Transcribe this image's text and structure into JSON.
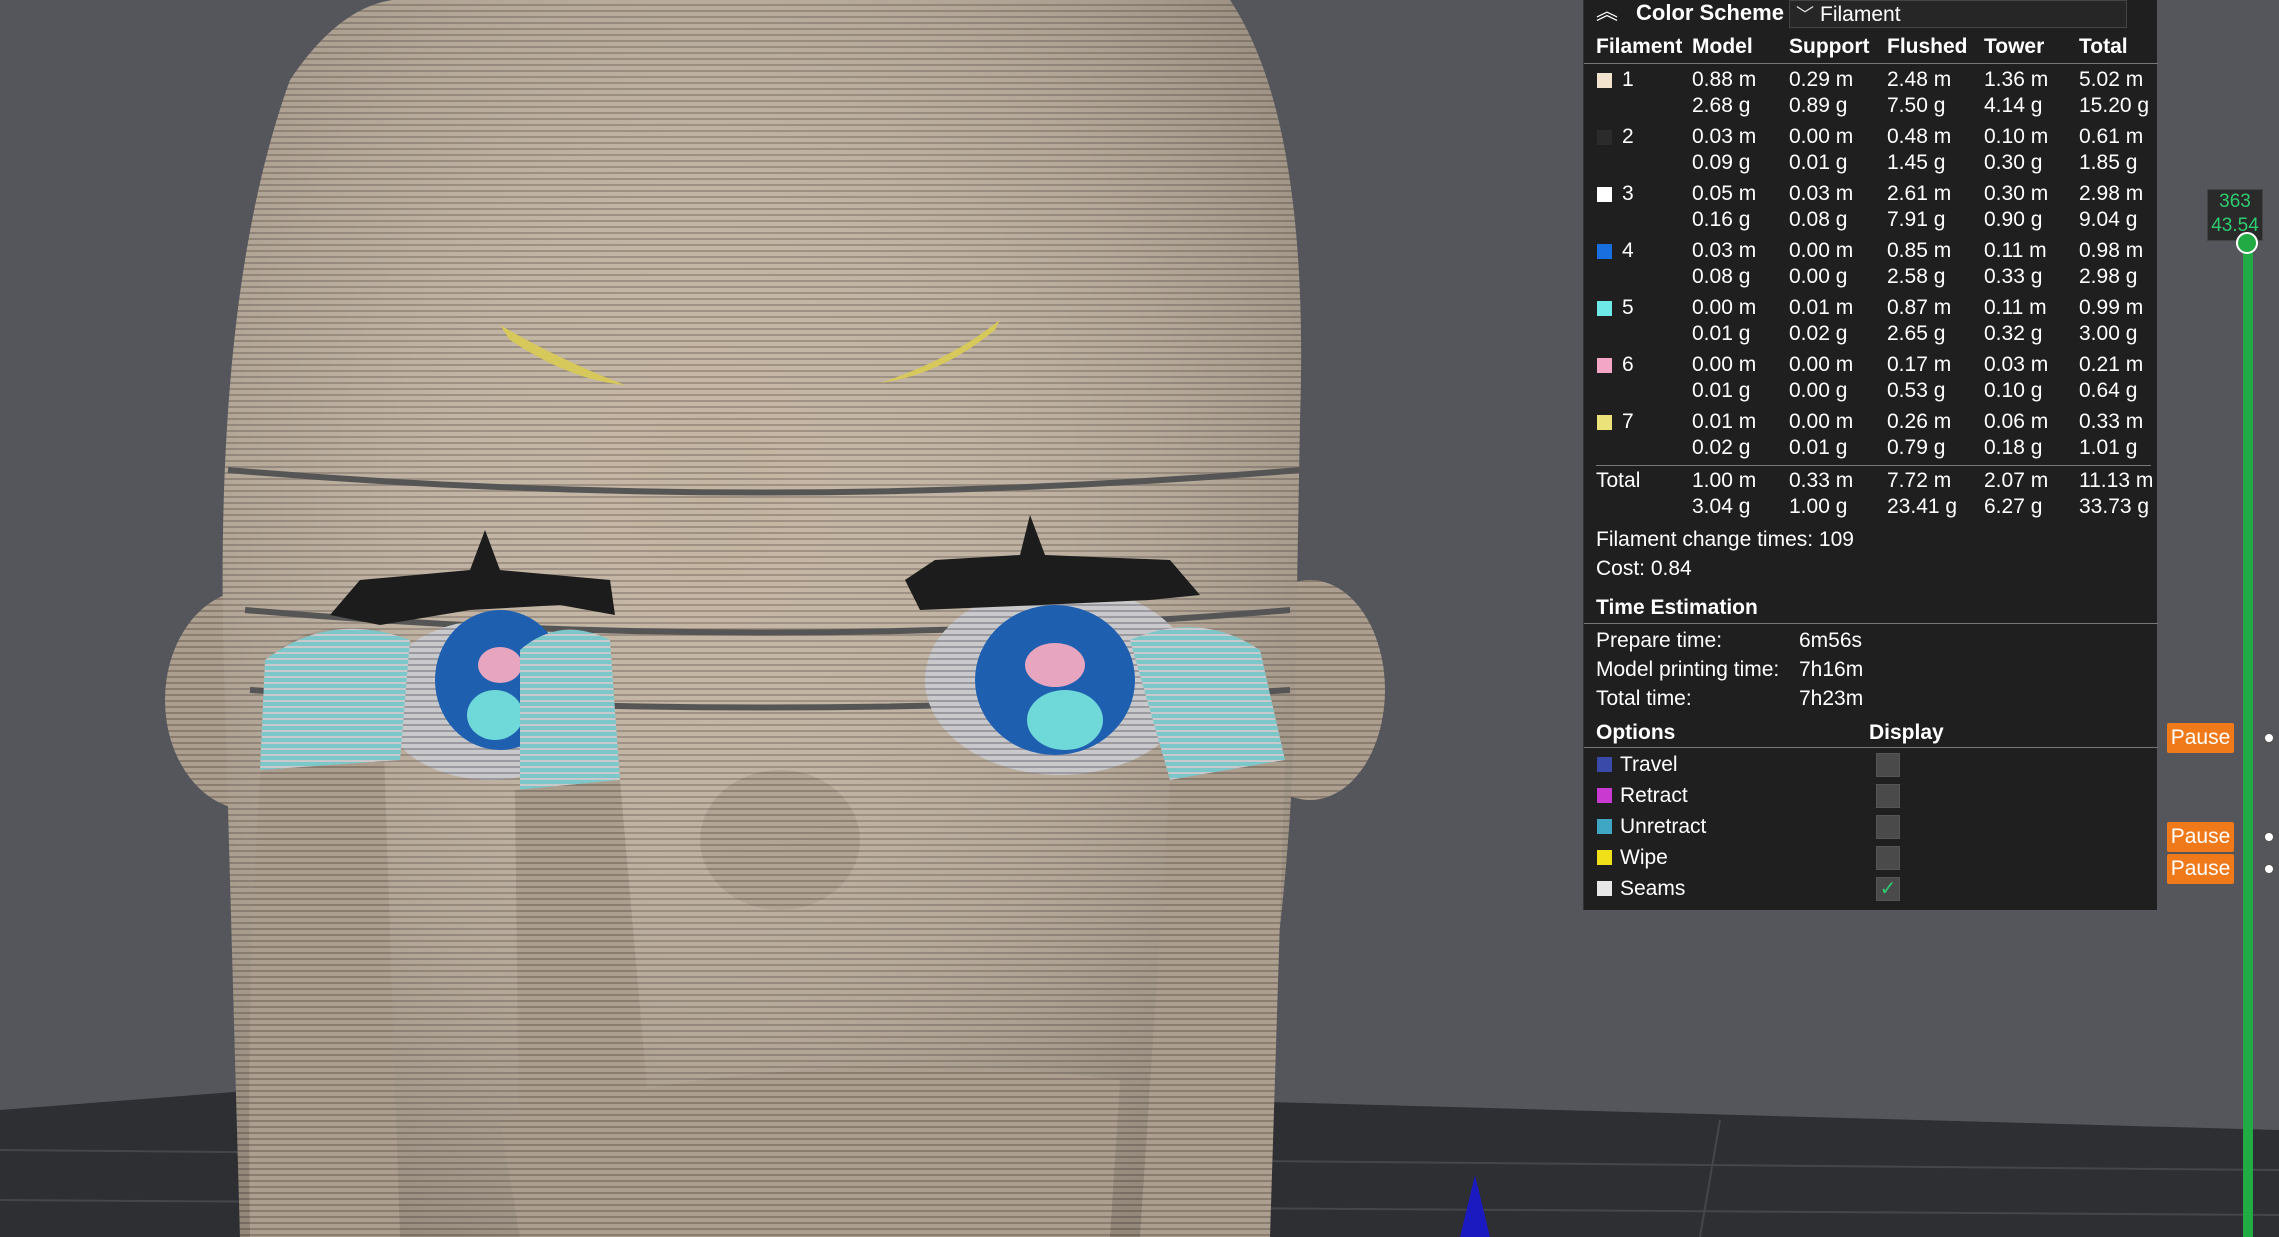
{
  "colors": {
    "background": "#55565c",
    "panel": "#1f1f1f",
    "accent_green": "#22aa44",
    "pause_orange": "#f07a1a"
  },
  "legend": {
    "collapse_icon": "chevron-up-icon",
    "title": "Color Scheme",
    "scheme_value": "Filament",
    "headers": [
      "Filament",
      "Model",
      "Support",
      "Flushed",
      "Tower",
      "Total"
    ],
    "filaments": [
      {
        "id": "1",
        "color": "#f2e3cf",
        "model": [
          "0.88 m",
          "2.68 g"
        ],
        "support": [
          "0.29 m",
          "0.89 g"
        ],
        "flushed": [
          "2.48 m",
          "7.50 g"
        ],
        "tower": [
          "1.36 m",
          "4.14 g"
        ],
        "total": [
          "5.02 m",
          "15.20 g"
        ]
      },
      {
        "id": "2",
        "color": "#2b2b2b",
        "model": [
          "0.03 m",
          "0.09 g"
        ],
        "support": [
          "0.00 m",
          "0.01 g"
        ],
        "flushed": [
          "0.48 m",
          "1.45 g"
        ],
        "tower": [
          "0.10 m",
          "0.30 g"
        ],
        "total": [
          "0.61 m",
          "1.85 g"
        ]
      },
      {
        "id": "3",
        "color": "#ffffff",
        "model": [
          "0.05 m",
          "0.16 g"
        ],
        "support": [
          "0.03 m",
          "0.08 g"
        ],
        "flushed": [
          "2.61 m",
          "7.91 g"
        ],
        "tower": [
          "0.30 m",
          "0.90 g"
        ],
        "total": [
          "2.98 m",
          "9.04 g"
        ]
      },
      {
        "id": "4",
        "color": "#1a6fe0",
        "model": [
          "0.03 m",
          "0.08 g"
        ],
        "support": [
          "0.00 m",
          "0.00 g"
        ],
        "flushed": [
          "0.85 m",
          "2.58 g"
        ],
        "tower": [
          "0.11 m",
          "0.33 g"
        ],
        "total": [
          "0.98 m",
          "2.98 g"
        ]
      },
      {
        "id": "5",
        "color": "#6fe8e8",
        "model": [
          "0.00 m",
          "0.01 g"
        ],
        "support": [
          "0.01 m",
          "0.02 g"
        ],
        "flushed": [
          "0.87 m",
          "2.65 g"
        ],
        "tower": [
          "0.11 m",
          "0.32 g"
        ],
        "total": [
          "0.99 m",
          "3.00 g"
        ]
      },
      {
        "id": "6",
        "color": "#f4a6c6",
        "model": [
          "0.00 m",
          "0.01 g"
        ],
        "support": [
          "0.00 m",
          "0.00 g"
        ],
        "flushed": [
          "0.17 m",
          "0.53 g"
        ],
        "tower": [
          "0.03 m",
          "0.10 g"
        ],
        "total": [
          "0.21 m",
          "0.64 g"
        ]
      },
      {
        "id": "7",
        "color": "#ece27a",
        "model": [
          "0.01 m",
          "0.02 g"
        ],
        "support": [
          "0.00 m",
          "0.01 g"
        ],
        "flushed": [
          "0.26 m",
          "0.79 g"
        ],
        "tower": [
          "0.06 m",
          "0.18 g"
        ],
        "total": [
          "0.33 m",
          "1.01 g"
        ]
      }
    ],
    "total": {
      "label": "Total",
      "model": [
        "1.00 m",
        "3.04 g"
      ],
      "support": [
        "0.33 m",
        "1.00 g"
      ],
      "flushed": [
        "7.72 m",
        "23.41 g"
      ],
      "tower": [
        "2.07 m",
        "6.27 g"
      ],
      "total": [
        "11.13 m",
        "33.73 g"
      ]
    },
    "filament_change": "Filament change times: 109",
    "cost": "Cost: 0.84",
    "time_title": "Time Estimation",
    "times": [
      {
        "label": "Prepare time:",
        "value": "6m56s"
      },
      {
        "label": "Model printing time:",
        "value": "7h16m"
      },
      {
        "label": "Total time:",
        "value": "7h23m"
      }
    ],
    "options_header": "Options",
    "display_header": "Display",
    "options": [
      {
        "label": "Travel",
        "color": "#3a4aa8",
        "checked": false
      },
      {
        "label": "Retract",
        "color": "#c83ad0",
        "checked": false
      },
      {
        "label": "Unretract",
        "color": "#3fa6c4",
        "checked": false
      },
      {
        "label": "Wipe",
        "color": "#f0e01a",
        "checked": false
      },
      {
        "label": "Seams",
        "color": "#e8e8e8",
        "checked": true
      }
    ]
  },
  "slider": {
    "layer": "363",
    "height": "43.54",
    "pause_label": "Pause"
  }
}
